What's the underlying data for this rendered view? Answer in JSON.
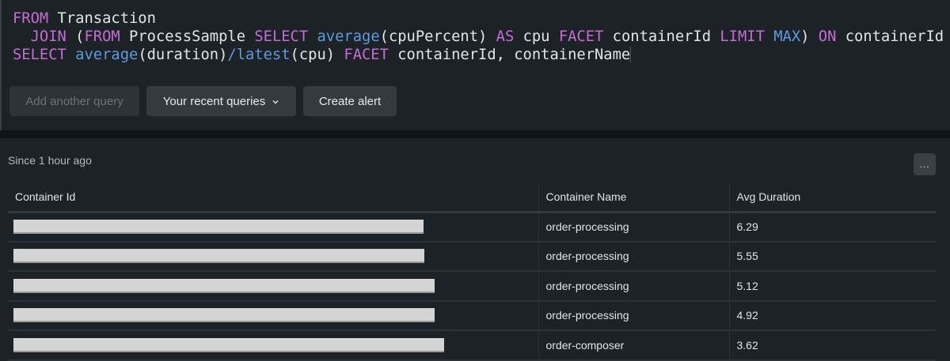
{
  "query": {
    "line1": [
      {
        "t": "FROM",
        "c": "kw"
      },
      {
        "t": " Transaction",
        "c": ""
      }
    ],
    "line2": [
      {
        "t": "  ",
        "c": ""
      },
      {
        "t": "JOIN",
        "c": "kw"
      },
      {
        "t": " (",
        "c": ""
      },
      {
        "t": "FROM",
        "c": "kw"
      },
      {
        "t": " ProcessSample ",
        "c": ""
      },
      {
        "t": "SELECT",
        "c": "kw"
      },
      {
        "t": " ",
        "c": ""
      },
      {
        "t": "average",
        "c": "fn"
      },
      {
        "t": "(cpuPercent) ",
        "c": ""
      },
      {
        "t": "AS",
        "c": "kw"
      },
      {
        "t": " cpu ",
        "c": ""
      },
      {
        "t": "FACET",
        "c": "kw"
      },
      {
        "t": " containerId ",
        "c": ""
      },
      {
        "t": "LIMIT",
        "c": "kw"
      },
      {
        "t": " ",
        "c": ""
      },
      {
        "t": "MAX",
        "c": "fn"
      },
      {
        "t": ") ",
        "c": ""
      },
      {
        "t": "ON",
        "c": "kw"
      },
      {
        "t": " containerId",
        "c": ""
      }
    ],
    "line3": [
      {
        "t": "SELECT",
        "c": "kw"
      },
      {
        "t": " ",
        "c": ""
      },
      {
        "t": "average",
        "c": "fn"
      },
      {
        "t": "(duration)",
        "c": ""
      },
      {
        "t": "/latest",
        "c": "fn"
      },
      {
        "t": "(cpu) ",
        "c": ""
      },
      {
        "t": "FACET",
        "c": "kw"
      },
      {
        "t": " containerId, containerName",
        "c": ""
      }
    ]
  },
  "toolbar": {
    "add_query": "Add another query",
    "recent_queries": "Your recent queries",
    "create_alert": "Create alert"
  },
  "result": {
    "since": "Since 1 hour ago",
    "more_label": "...",
    "columns": [
      "Container Id",
      "Container Name",
      "Avg Duration"
    ],
    "rows": [
      {
        "container_id_redacted": true,
        "name": "order-processing",
        "avg": "6.29"
      },
      {
        "container_id_redacted": true,
        "name": "order-processing",
        "avg": "5.55"
      },
      {
        "container_id_redacted": true,
        "name": "order-processing",
        "avg": "5.12"
      },
      {
        "container_id_redacted": true,
        "name": "order-processing",
        "avg": "4.92"
      },
      {
        "container_id_redacted": true,
        "name": "order-composer",
        "avg": "3.62"
      }
    ]
  },
  "colors": {
    "keyword": "#c46dd4",
    "function": "#5c9ce0",
    "background": "#1d2226"
  }
}
